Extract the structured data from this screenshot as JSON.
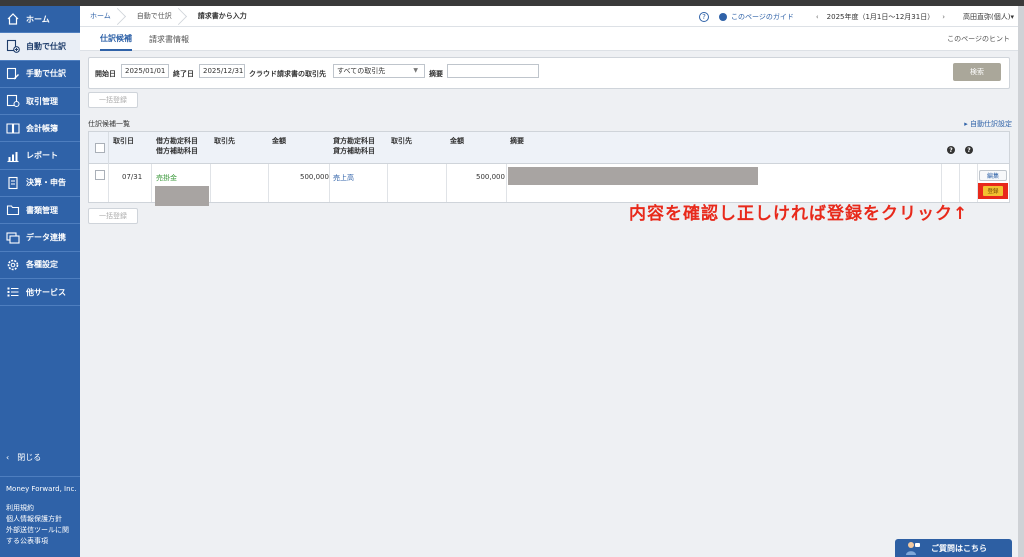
{
  "sidebar": {
    "items": [
      {
        "label": "ホーム",
        "icon": "home-icon"
      },
      {
        "label": "自動で仕訳",
        "icon": "auto-journal-icon",
        "active": true
      },
      {
        "label": "手動で仕訳",
        "icon": "manual-journal-icon"
      },
      {
        "label": "取引管理",
        "icon": "transaction-icon"
      },
      {
        "label": "会計帳簿",
        "icon": "ledger-icon"
      },
      {
        "label": "レポート",
        "icon": "report-icon"
      },
      {
        "label": "決算・申告",
        "icon": "settlement-icon"
      },
      {
        "label": "書類管理",
        "icon": "folder-icon"
      },
      {
        "label": "データ連携",
        "icon": "data-link-icon"
      },
      {
        "label": "各種設定",
        "icon": "gear-icon"
      },
      {
        "label": "他サービス",
        "icon": "list-icon"
      }
    ],
    "close_label": "閉じる",
    "footer": {
      "brand": "Money Forward, Inc.",
      "links": [
        "利用規約",
        "個人情報保護方針",
        "外部送信ツールに関",
        "する公表事項"
      ]
    }
  },
  "breadcrumb": [
    "ホーム",
    "自動で仕訳",
    "請求書から入力"
  ],
  "header": {
    "help": "?",
    "guide": "このページのガイド",
    "period": "2025年度（1月1日〜12月31日）",
    "user": "高田直弥(個人)▾"
  },
  "tabs": [
    "仕訳候補",
    "請求書情報"
  ],
  "hint": "このページのヒント",
  "filter": {
    "start_label": "開始日",
    "start_value": "2025/01/01",
    "end_label": "終了日",
    "end_value": "2025/12/31",
    "partner_label": "クラウド請求書の取引先",
    "partner_value": "すべての取引先",
    "summary_label": "摘要",
    "summary_value": "",
    "search_label": "検索"
  },
  "bulk_register_label": "一括登録",
  "section_title": "仕訳候補一覧",
  "auto_setting_label": "▸ 自動仕訳設定",
  "table": {
    "headers": {
      "date": "取引日",
      "debit_account": "借方勘定科目",
      "debit_sub": "借方補助科目",
      "debit_partner": "取引先",
      "debit_amount": "金額",
      "credit_account": "貸方勘定科目",
      "credit_sub": "貸方補助科目",
      "credit_partner": "取引先",
      "credit_amount": "金額",
      "summary": "摘要",
      "q1": "?",
      "q2": "?"
    },
    "row": {
      "date": "07/31",
      "debit_account": "売掛金",
      "debit_amount": "500,000",
      "credit_account": "売上高",
      "credit_amount": "500,000",
      "edit_label": "編集",
      "register_label": "登録"
    }
  },
  "annotation": "内容を確認し正しければ登録をクリック↑",
  "contact_label": "ご質問はこちら"
}
